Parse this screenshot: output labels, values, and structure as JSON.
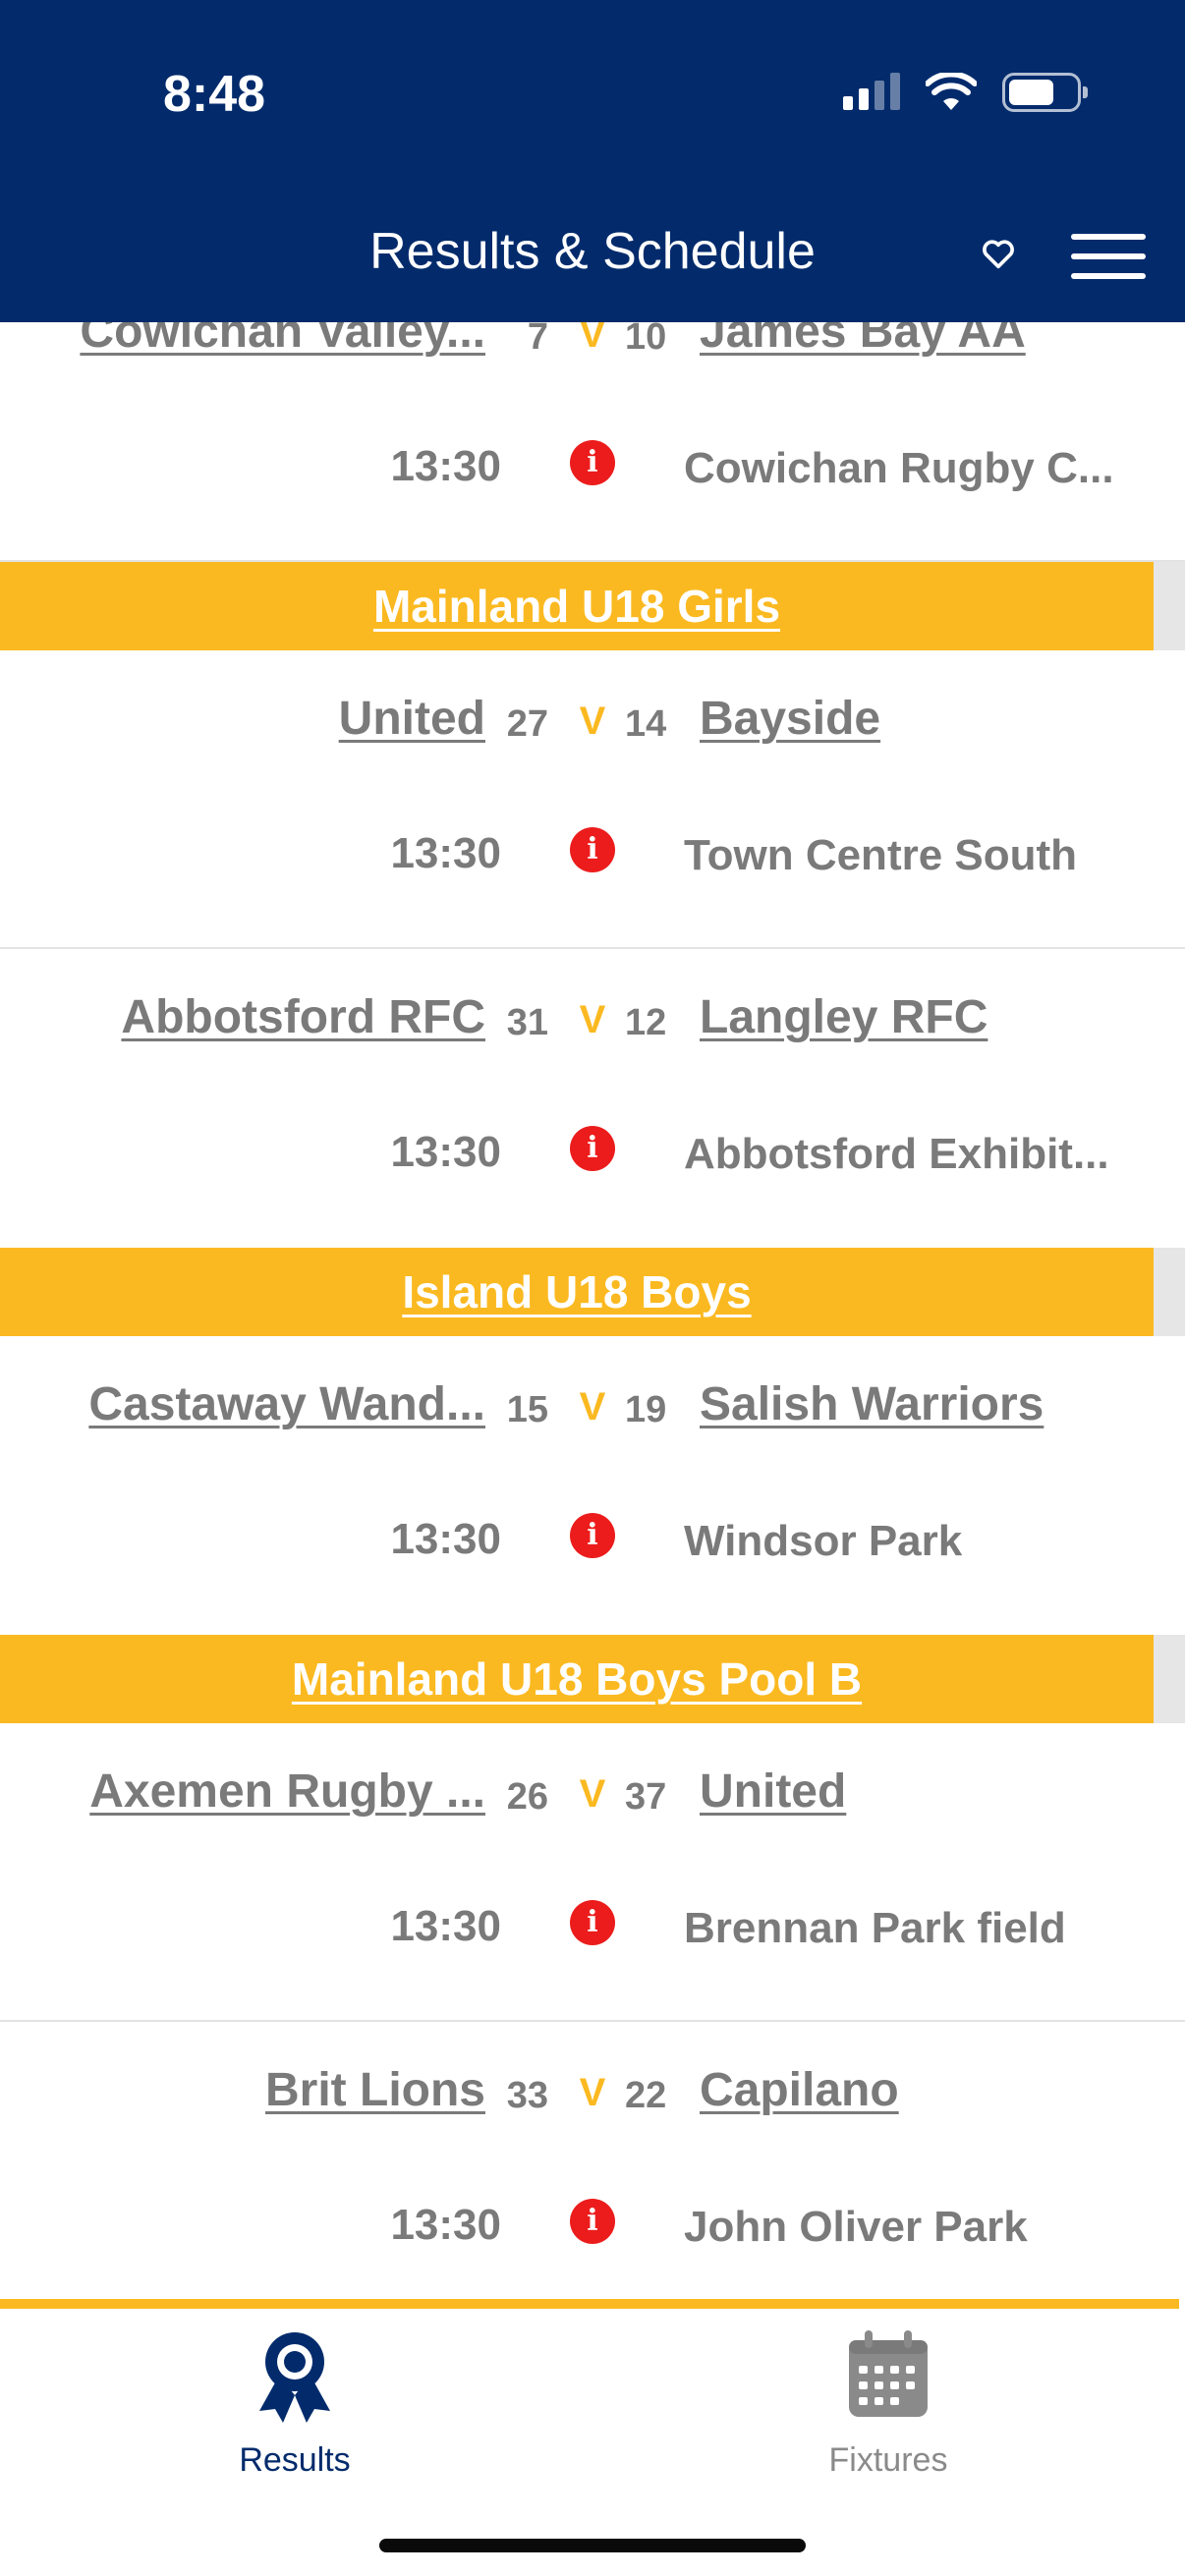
{
  "status_bar": {
    "time": "8:48"
  },
  "header": {
    "title": "Results & Schedule"
  },
  "colors": {
    "navy": "#032B6C",
    "gold": "#FBB921",
    "info_red": "#EC1C1C",
    "text_gray": "#7A7A7A"
  },
  "icons": {
    "favorite": "heart-outline-icon",
    "menu": "hamburger-menu-icon",
    "info": "info-icon",
    "results": "award-ribbon-icon",
    "fixtures": "calendar-icon"
  },
  "groups": [
    {
      "title": null,
      "matches": [
        {
          "home": "Cowichan Valley...",
          "home_score": "7",
          "away_score": "10",
          "away": "James Bay AA",
          "time": "13:30",
          "venue": "Cowichan Rugby C..."
        }
      ]
    },
    {
      "title": "Mainland U18 Girls",
      "matches": [
        {
          "home": "United",
          "home_score": "27",
          "away_score": "14",
          "away": "Bayside",
          "time": "13:30",
          "venue": "Town Centre South"
        },
        {
          "home": "Abbotsford RFC",
          "home_score": "31",
          "away_score": "12",
          "away": "Langley RFC",
          "time": "13:30",
          "venue": "Abbotsford Exhibit..."
        }
      ]
    },
    {
      "title": "Island U18 Boys",
      "matches": [
        {
          "home": "Castaway Wand...",
          "home_score": "15",
          "away_score": "19",
          "away": "Salish Warriors",
          "time": "13:30",
          "venue": "Windsor Park"
        }
      ]
    },
    {
      "title": "Mainland U18 Boys Pool B",
      "matches": [
        {
          "home": "Axemen Rugby ...",
          "home_score": "26",
          "away_score": "37",
          "away": "United",
          "time": "13:30",
          "venue": "Brennan Park field"
        },
        {
          "home": "Brit Lions",
          "home_score": "33",
          "away_score": "22",
          "away": "Capilano",
          "time": "13:30",
          "venue": "John Oliver Park"
        }
      ]
    }
  ],
  "versus_label": "V",
  "info_glyph": "i",
  "tabs": [
    {
      "label": "Results",
      "active": true
    },
    {
      "label": "Fixtures",
      "active": false
    }
  ]
}
